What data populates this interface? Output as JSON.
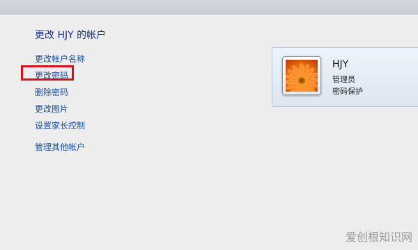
{
  "page": {
    "title": "更改 HJY 的帐户"
  },
  "tasks": [
    "更改帐户名称",
    "更改密码",
    "删除密码",
    "更改图片",
    "设置家长控制",
    "管理其他帐户"
  ],
  "account": {
    "name": "HJY",
    "type": "管理员",
    "status": "密码保护"
  },
  "watermark": "爱创根知识网",
  "colors": {
    "link": "#1a4fa0",
    "title": "#1e3287",
    "highlight": "#d3121b"
  }
}
